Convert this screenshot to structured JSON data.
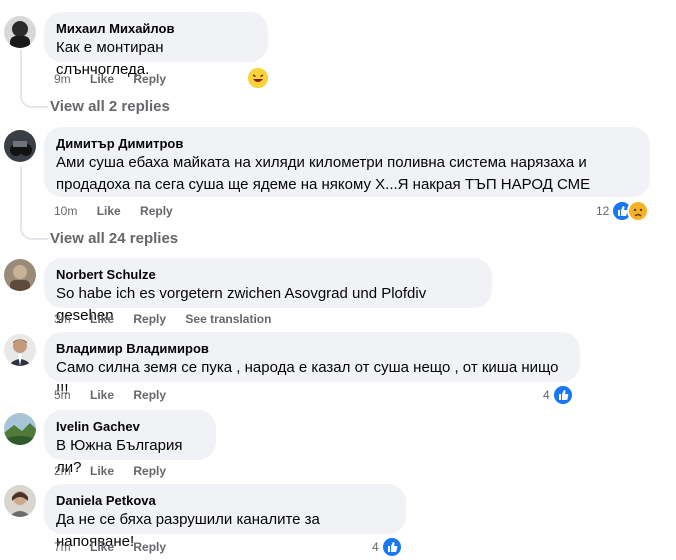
{
  "actions": {
    "like": "Like",
    "reply": "Reply",
    "see_translation": "See translation"
  },
  "comments": [
    {
      "name": "Михаил Михайлов",
      "lines": [
        "Как е монтиран слънчогледа."
      ],
      "time": "9m"
    },
    {
      "name": "Димитър Димитров",
      "lines": [
        "Ами суша ебаха майката на хиляди километри поливна система нарязаха и",
        "продадоха па сега суша ще ядеме на някому Х...Я накрая ТЪП НАРОД СМЕ"
      ],
      "time": "10m",
      "reactions": "12"
    },
    {
      "name": "Norbert Schulze",
      "lines": [
        "So habe ich es vorgetern zwichen Asovgrad und Plofdiv gesehen"
      ],
      "time": "3m"
    },
    {
      "name": "Владимир Владимиров",
      "lines": [
        "Само силна земя се пука , народа е казал от суша нещо , от киша нищо !!!"
      ],
      "time": "5m",
      "reactions": "4"
    },
    {
      "name": "Ivelin Gachev",
      "lines": [
        "В Южна България ли?"
      ],
      "time": "2m"
    },
    {
      "name": "Daniela Petkova",
      "lines": [
        "Да не се бяха разрушили каналите за напояване!"
      ],
      "time": "7m",
      "reactions": "4"
    }
  ],
  "view_replies": [
    "View all 2 replies",
    "View all 24 replies"
  ],
  "colors": {
    "bubble": "#f0f2f5",
    "meta": "#65676b",
    "like_blue": "#1877f2",
    "sad_yellow": "#f7b125"
  },
  "icons": [
    "like-reaction-icon",
    "sad-reaction-icon",
    "emoji-reaction-icon"
  ]
}
